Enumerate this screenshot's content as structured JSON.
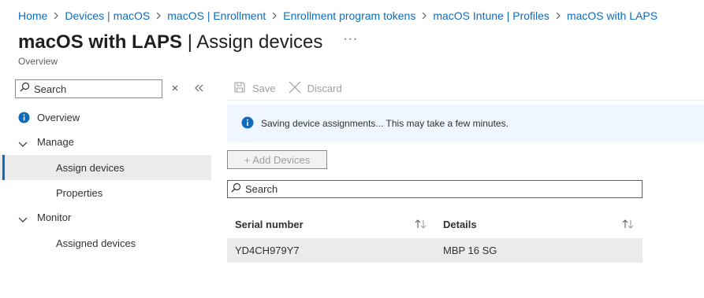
{
  "breadcrumb": [
    "Home",
    "Devices | macOS",
    "macOS | Enrollment",
    "Enrollment program tokens",
    "macOS Intune | Profiles",
    "macOS with LAPS"
  ],
  "header": {
    "title_bold": "macOS with LAPS",
    "title_rest": " | Assign devices",
    "more": "···",
    "subtitle": "Overview"
  },
  "sidebar": {
    "search_placeholder": "Search",
    "items": [
      {
        "label": "Overview"
      },
      {
        "label": "Manage"
      },
      {
        "label": "Assign devices"
      },
      {
        "label": "Properties"
      },
      {
        "label": "Monitor"
      },
      {
        "label": "Assigned devices"
      }
    ]
  },
  "toolbar": {
    "save": "Save",
    "discard": "Discard"
  },
  "banner": {
    "message": "Saving device assignments... This may take a few minutes."
  },
  "add_button": "+ Add Devices",
  "list_search_placeholder": "Search",
  "table": {
    "columns": [
      "Serial number",
      "Details"
    ],
    "rows": [
      [
        "YD4CH979Y7",
        "MBP 16 SG"
      ]
    ]
  },
  "colors": {
    "accent": "#0f6cbd",
    "info": "#0f6cbd",
    "banner_bg": "#f0f6ff",
    "selected_bg": "#edebe9"
  },
  "icons": [
    "chevron-right-icon",
    "ellipsis-icon",
    "search-icon",
    "close-icon",
    "collapse-icon",
    "info-icon",
    "chevron-down-icon",
    "save-icon",
    "discard-icon",
    "sort-icon"
  ]
}
